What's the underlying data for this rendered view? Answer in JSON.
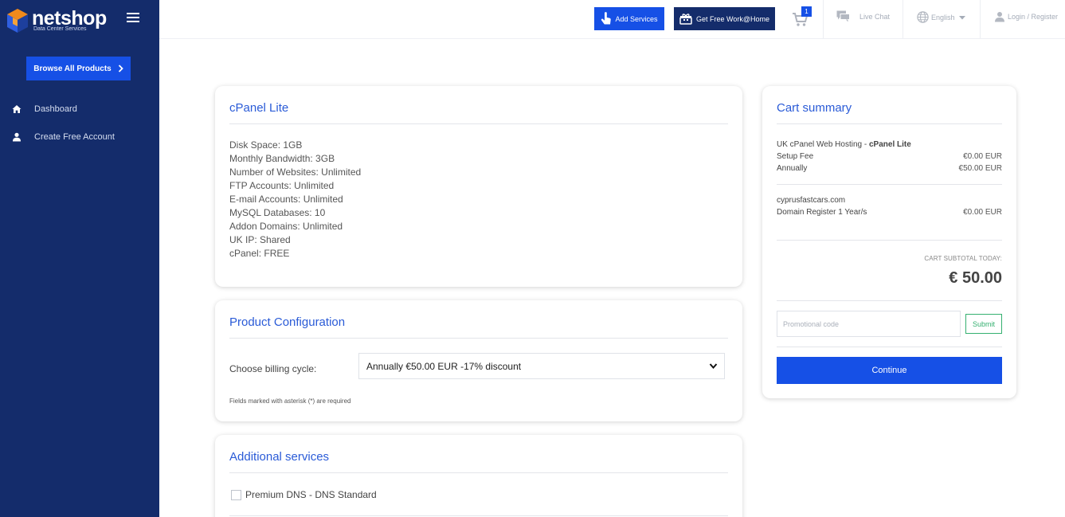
{
  "brand": {
    "name": "netshop",
    "subtitle": "Data Center Services"
  },
  "sidebar": {
    "browse_label": "Browse All Products",
    "items": [
      {
        "label": "Dashboard",
        "icon": "home-icon"
      },
      {
        "label": "Create Free Account",
        "icon": "user-icon"
      }
    ]
  },
  "topbar": {
    "add_services": "Add Services",
    "free_work": "Get Free Work@Home",
    "cart_count": "1",
    "live_chat": "Live Chat",
    "language": "English",
    "login": "Login / Register"
  },
  "product": {
    "title": "cPanel Lite",
    "specs": [
      "Disk Space: 1GB",
      "Monthly Bandwidth: 3GB",
      "Number of Websites: Unlimited",
      "FTP Accounts: Unlimited",
      "E-mail Accounts: Unlimited",
      "MySQL Databases: 10",
      "Addon Domains: Unlimited",
      "UK IP: Shared",
      "cPanel: FREE"
    ]
  },
  "config": {
    "title": "Product Configuration",
    "billing_label": "Choose billing cycle:",
    "billing_value": "Annually €50.00 EUR -17% discount",
    "required_note": "Fields marked with asterisk (*) are required"
  },
  "additional": {
    "title": "Additional services",
    "option_label": "Premium DNS - DNS Standard"
  },
  "summary": {
    "title": "Cart summary",
    "product_prefix": "UK cPanel Web Hosting - ",
    "product_name": "cPanel Lite",
    "setup_fee_label": "Setup Fee",
    "setup_fee_value": "€0.00 EUR",
    "annually_label": "Annually",
    "annually_value": "€50.00 EUR",
    "domain": "cyprusfastcars.com",
    "domain_label": "Domain Register 1 Year/s",
    "domain_value": "€0.00 EUR",
    "subtotal_label": "CART SUBTOTAL TODAY:",
    "subtotal_value": "€ 50.00",
    "promo_placeholder": "Promotional code",
    "submit_label": "Submit",
    "continue_label": "Continue"
  },
  "colors": {
    "sidebar_bg": "#142c6b",
    "accent_blue": "#1650e6",
    "title_blue": "#2a5bd7",
    "submit_green": "#35b070"
  }
}
